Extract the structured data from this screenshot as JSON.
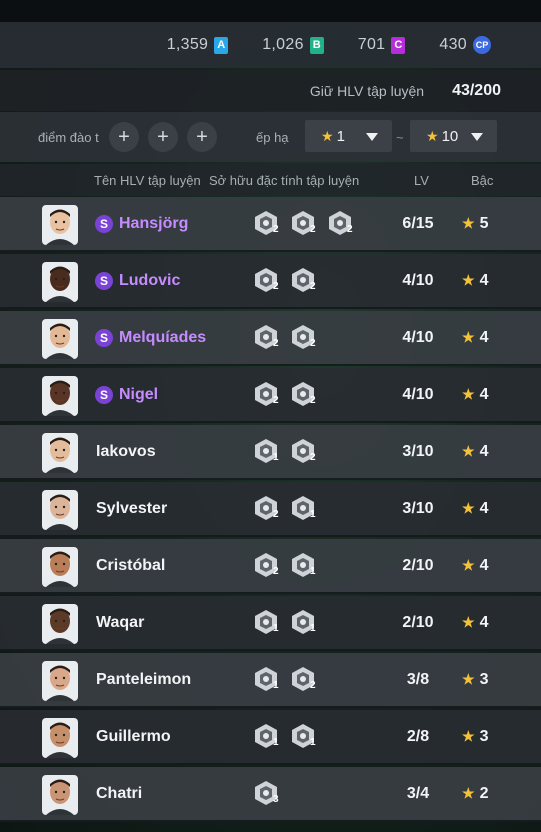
{
  "currencies": [
    {
      "value": "1,359",
      "badge": "A",
      "color": "#2aa7e6"
    },
    {
      "value": "1,026",
      "badge": "B",
      "color": "#21b28a"
    },
    {
      "value": "701",
      "badge": "C",
      "color": "#b52fd9"
    },
    {
      "value": "430",
      "badge": "CP",
      "color": "#3b6ae0"
    }
  ],
  "hold": {
    "label": "Giữ HLV tập luyện",
    "count": "43/200"
  },
  "filter": {
    "points_label": "điểm đào t",
    "plus_symbol": "+",
    "rank_label": "ếp hạ",
    "rank_min": "1",
    "rank_max": "10",
    "tilde": "~"
  },
  "columns": {
    "name": "Tên HLV tập luyện",
    "traits": "Sở hữu đặc tính tập luyện",
    "lv": "LV",
    "rank": "Bậc"
  },
  "special_badge": "S",
  "star": "★",
  "coaches": [
    {
      "name": "Hansjörg",
      "special": true,
      "lv": "6/15",
      "rank": "5",
      "traits": [
        {
          "icon": "wing-icon",
          "level": "2"
        },
        {
          "icon": "swirl-icon",
          "level": "2"
        },
        {
          "icon": "ball-icon",
          "level": "2"
        }
      ],
      "skin": "#e9c2a2"
    },
    {
      "name": "Ludovic",
      "special": true,
      "lv": "4/10",
      "rank": "4",
      "traits": [
        {
          "icon": "ball-icon",
          "level": "2"
        },
        {
          "icon": "wall-icon",
          "level": "2"
        }
      ],
      "skin": "#4a2c1e"
    },
    {
      "name": "Melquíades",
      "special": true,
      "lv": "4/10",
      "rank": "4",
      "traits": [
        {
          "icon": "wing-icon",
          "level": "2"
        },
        {
          "icon": "kick-icon",
          "level": "2"
        }
      ],
      "skin": "#e2b896"
    },
    {
      "name": "Nigel",
      "special": true,
      "lv": "4/10",
      "rank": "4",
      "traits": [
        {
          "icon": "wing-icon",
          "level": "2"
        },
        {
          "icon": "target-icon",
          "level": "2"
        }
      ],
      "skin": "#5a3425"
    },
    {
      "name": "Iakovos",
      "special": false,
      "lv": "3/10",
      "rank": "4",
      "traits": [
        {
          "icon": "tackle-icon",
          "level": "1"
        },
        {
          "icon": "kick-icon",
          "level": "2"
        }
      ],
      "skin": "#e3bc9c"
    },
    {
      "name": "Sylvester",
      "special": false,
      "lv": "3/10",
      "rank": "4",
      "traits": [
        {
          "icon": "shield-icon",
          "level": "2"
        },
        {
          "icon": "scissors-icon",
          "level": "1"
        }
      ],
      "skin": "#dcb49a"
    },
    {
      "name": "Cristóbal",
      "special": false,
      "lv": "2/10",
      "rank": "4",
      "traits": [
        {
          "icon": "goal-icon",
          "level": "2"
        },
        {
          "icon": "hand-icon",
          "level": "1"
        }
      ],
      "skin": "#b97e58"
    },
    {
      "name": "Waqar",
      "special": false,
      "lv": "2/10",
      "rank": "4",
      "traits": [
        {
          "icon": "whistle-icon",
          "level": "1"
        },
        {
          "icon": "whistle-icon",
          "level": "1"
        }
      ],
      "skin": "#5c3a28"
    },
    {
      "name": "Panteleimon",
      "special": false,
      "lv": "3/8",
      "rank": "3",
      "traits": [
        {
          "icon": "tackle-icon",
          "level": "1"
        },
        {
          "icon": "ball-icon",
          "level": "2"
        }
      ],
      "skin": "#d9a88a"
    },
    {
      "name": "Guillermo",
      "special": false,
      "lv": "2/8",
      "rank": "3",
      "traits": [
        {
          "icon": "head-icon",
          "level": "1"
        },
        {
          "icon": "kick-icon",
          "level": "1"
        }
      ],
      "skin": "#c58f6a"
    },
    {
      "name": "Chatri",
      "special": false,
      "lv": "3/4",
      "rank": "2",
      "traits": [
        {
          "icon": "tackle-icon",
          "level": "3"
        }
      ],
      "skin": "#c99574"
    }
  ]
}
